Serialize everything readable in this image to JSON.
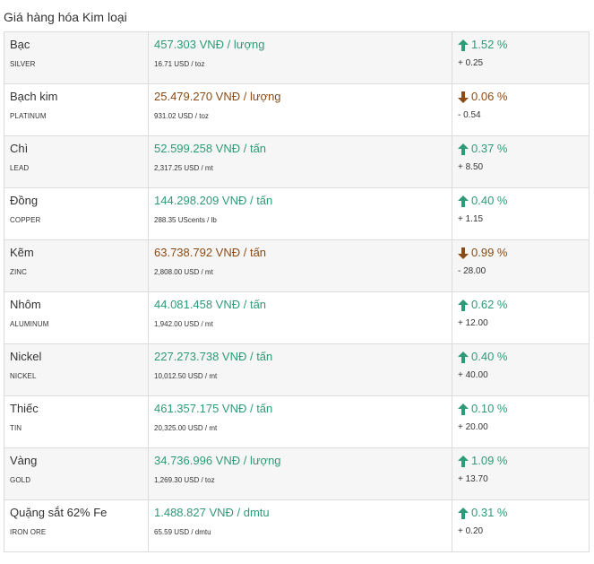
{
  "page_title": "Giá hàng hóa Kim loại",
  "colors": {
    "up": "#2e9a78",
    "down": "#8a4b16"
  },
  "rows": [
    {
      "name": "Bạc",
      "code": "SILVER",
      "price": "457.303 VNĐ / lượng",
      "world": "16.71 USD / toz",
      "direction": "up",
      "pct": "1.52 %",
      "abs": "+ 0.25"
    },
    {
      "name": "Bạch kim",
      "code": "PLATINUM",
      "price": "25.479.270 VNĐ / lượng",
      "world": "931.02 USD / toz",
      "direction": "down",
      "pct": "0.06 %",
      "abs": "- 0.54"
    },
    {
      "name": "Chì",
      "code": "LEAD",
      "price": "52.599.258 VNĐ / tấn",
      "world": "2,317.25 USD / mt",
      "direction": "up",
      "pct": "0.37 %",
      "abs": "+ 8.50"
    },
    {
      "name": "Đồng",
      "code": "COPPER",
      "price": "144.298.209 VNĐ / tấn",
      "world": "288.35 UScents / lb",
      "direction": "up",
      "pct": "0.40 %",
      "abs": "+ 1.15"
    },
    {
      "name": "Kẽm",
      "code": "ZINC",
      "price": "63.738.792 VNĐ / tấn",
      "world": "2,808.00 USD / mt",
      "direction": "down",
      "pct": "0.99 %",
      "abs": "- 28.00"
    },
    {
      "name": "Nhôm",
      "code": "ALUMINUM",
      "price": "44.081.458 VNĐ / tấn",
      "world": "1,942.00 USD / mt",
      "direction": "up",
      "pct": "0.62 %",
      "abs": "+ 12.00"
    },
    {
      "name": "Nickel",
      "code": "NICKEL",
      "price": "227.273.738 VNĐ / tấn",
      "world": "10,012.50 USD / mt",
      "direction": "up",
      "pct": "0.40 %",
      "abs": "+ 40.00"
    },
    {
      "name": "Thiếc",
      "code": "TIN",
      "price": "461.357.175 VNĐ / tấn",
      "world": "20,325.00 USD / mt",
      "direction": "up",
      "pct": "0.10 %",
      "abs": "+ 20.00"
    },
    {
      "name": "Vàng",
      "code": "GOLD",
      "price": "34.736.996 VNĐ / lượng",
      "world": "1,269.30 USD / toz",
      "direction": "up",
      "pct": "1.09 %",
      "abs": "+ 13.70"
    },
    {
      "name": "Quặng sắt 62% Fe",
      "code": "IRON ORE",
      "price": "1.488.827 VNĐ / dmtu",
      "world": "65.59 USD / dmtu",
      "direction": "up",
      "pct": "0.31 %",
      "abs": "+ 0.20"
    }
  ]
}
